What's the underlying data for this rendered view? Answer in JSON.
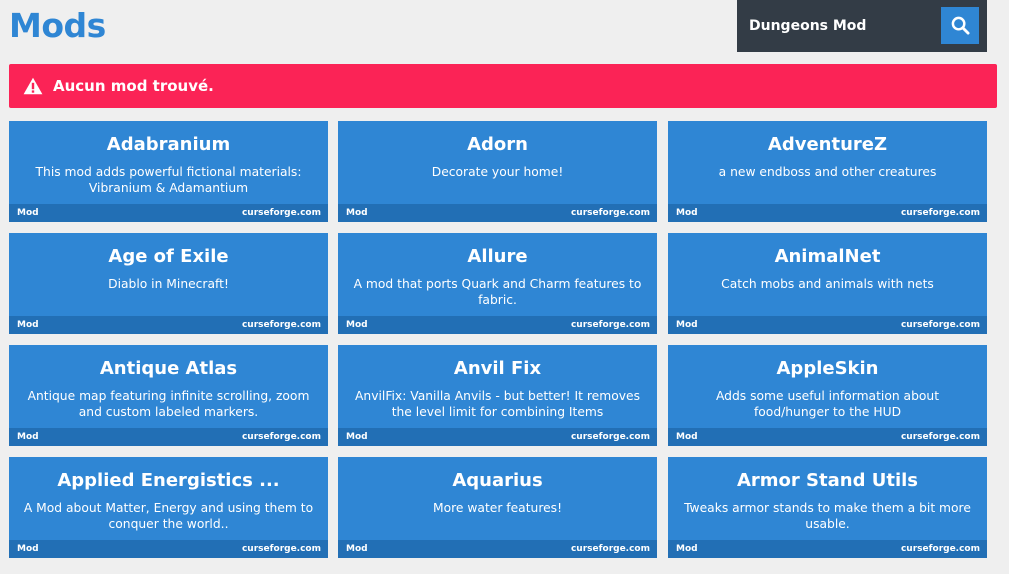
{
  "header": {
    "title": "Mods"
  },
  "search": {
    "value": "Dungeons Mod",
    "placeholder": ""
  },
  "alert": {
    "text": "Aucun mod trouvé."
  },
  "colors": {
    "accent": "#2f86d4",
    "alert": "#fb2356",
    "search_bg": "#333c46",
    "footer": "#226fb5"
  },
  "mods": [
    {
      "title": "Adabranium",
      "description": "This mod adds powerful fictional materials: Vibranium & Adamantium",
      "type": "Mod",
      "source": "curseforge.com"
    },
    {
      "title": "Adorn",
      "description": "Decorate your home!",
      "type": "Mod",
      "source": "curseforge.com"
    },
    {
      "title": "AdventureZ",
      "description": "a new endboss and other creatures",
      "type": "Mod",
      "source": "curseforge.com"
    },
    {
      "title": "Age of Exile",
      "description": "Diablo in Minecraft!",
      "type": "Mod",
      "source": "curseforge.com"
    },
    {
      "title": "Allure",
      "description": "A mod that ports Quark and Charm features to fabric.",
      "type": "Mod",
      "source": "curseforge.com"
    },
    {
      "title": "AnimalNet",
      "description": "Catch mobs and animals with nets",
      "type": "Mod",
      "source": "curseforge.com"
    },
    {
      "title": "Antique Atlas",
      "description": "Antique map featuring infinite scrolling, zoom and custom labeled markers.",
      "type": "Mod",
      "source": "curseforge.com"
    },
    {
      "title": "Anvil Fix",
      "description": "AnvilFix: Vanilla Anvils - but better! It removes the level limit for combining Items",
      "type": "Mod",
      "source": "curseforge.com"
    },
    {
      "title": "AppleSkin",
      "description": "Adds some useful information about food/hunger to the HUD",
      "type": "Mod",
      "source": "curseforge.com"
    },
    {
      "title": "Applied Energistics ...",
      "description": "A Mod about Matter, Energy and using them to conquer the world..",
      "type": "Mod",
      "source": "curseforge.com"
    },
    {
      "title": "Aquarius",
      "description": "More water features!",
      "type": "Mod",
      "source": "curseforge.com"
    },
    {
      "title": "Armor Stand Utils",
      "description": "Tweaks armor stands to make them a bit more usable.",
      "type": "Mod",
      "source": "curseforge.com"
    }
  ]
}
